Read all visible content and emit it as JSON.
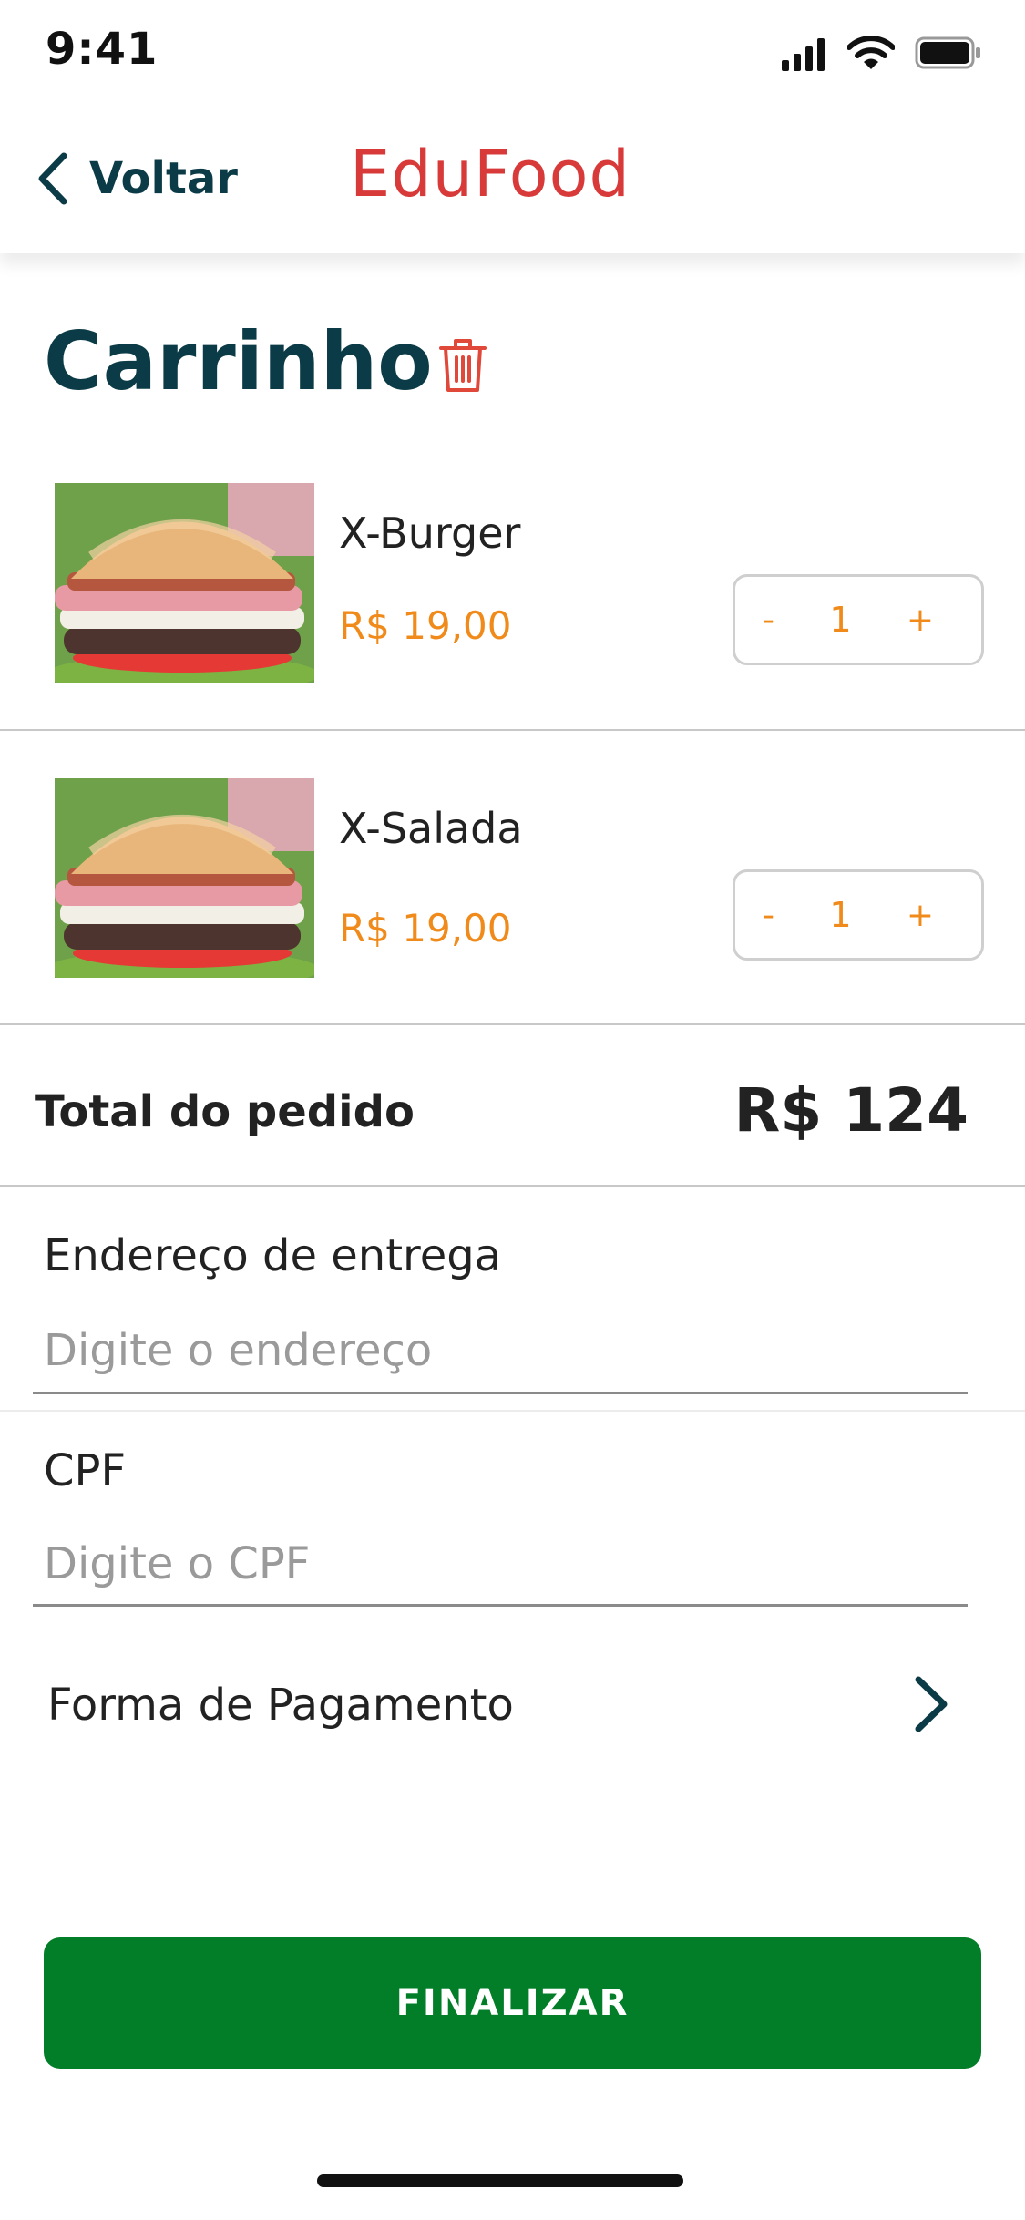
{
  "status_bar": {
    "time": "9:41"
  },
  "nav": {
    "back_label": "Voltar",
    "brand": "EduFood"
  },
  "cart": {
    "title": "Carrinho",
    "items": [
      {
        "name": "X-Burger",
        "price": "R$ 19,00",
        "quantity": "1",
        "decrement": "-",
        "increment": "+"
      },
      {
        "name": "X-Salada",
        "price": "R$ 19,00",
        "quantity": "1",
        "decrement": "-",
        "increment": "+"
      }
    ]
  },
  "total": {
    "label": "Total do pedido",
    "value": "R$ 124"
  },
  "form": {
    "address_label": "Endereço de entrega",
    "address_placeholder": "Digite o endereço",
    "cpf_label": "CPF",
    "cpf_placeholder": "Digite o CPF",
    "payment_label": "Forma de Pagamento"
  },
  "actions": {
    "finalize_label": "FINALIZAR"
  },
  "colors": {
    "brand": "#d83a3a",
    "accent": "#f08b1b",
    "primary_button": "#027d28",
    "title": "#0b3b46"
  },
  "icons": [
    "signal-icon",
    "wifi-icon",
    "battery-icon",
    "chevron-left-icon",
    "trash-icon",
    "burger-image",
    "chevron-right-icon"
  ]
}
